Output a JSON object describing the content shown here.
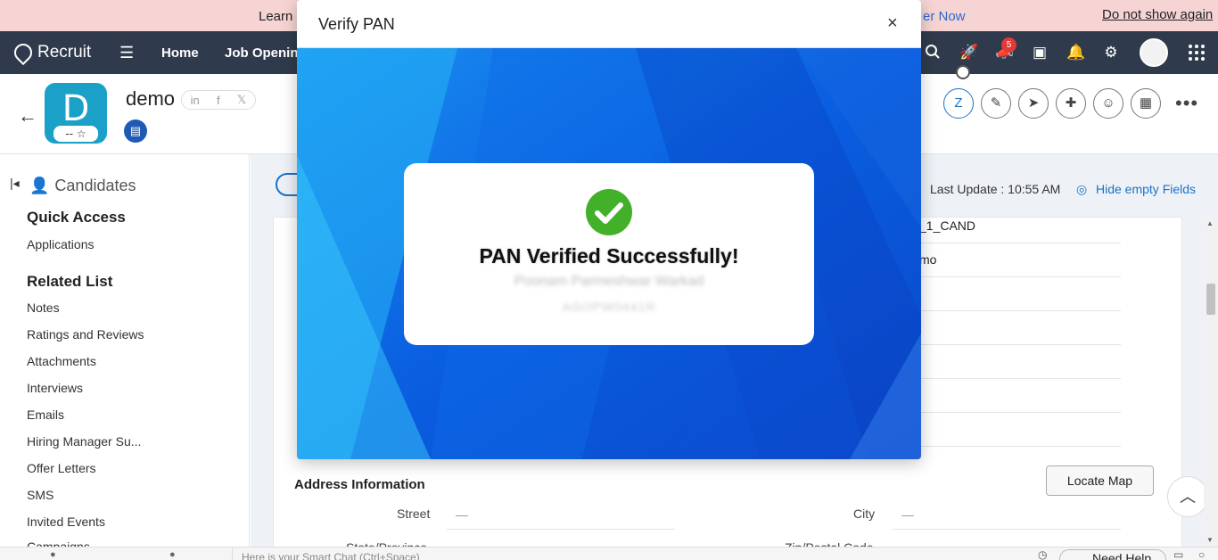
{
  "banner": {
    "learn_text": "Learn",
    "register_text": "er Now",
    "dismiss_text": "Do not show again"
  },
  "nav": {
    "app_name": "Recruit",
    "links": [
      "Home",
      "Job Opening"
    ],
    "notification_count": "5"
  },
  "record": {
    "initial": "D",
    "name": "demo",
    "rating": "-- ☆",
    "social": [
      "in",
      "f",
      "𝕏"
    ]
  },
  "sidebar": {
    "module": "Candidates",
    "quick_access_title": "Quick Access",
    "quick_access_items": [
      "Applications"
    ],
    "related_list_title": "Related List",
    "related_items": [
      "Notes",
      "Ratings and Reviews",
      "Attachments",
      "Interviews",
      "Emails",
      "Hiring Manager Su...",
      "Offer Letters",
      "SMS",
      "Invited Events",
      "Campaigns"
    ]
  },
  "main": {
    "last_update": "Last Update : 10:55 AM",
    "hide_empty": "Hide empty Fields",
    "field_values": [
      "_1_CAND",
      "mo",
      "",
      "",
      "",
      "",
      ""
    ],
    "address_title": "Address Information",
    "locate_map": "Locate Map",
    "street_label": "Street",
    "street_value": "—",
    "city_label": "City",
    "city_value": "—",
    "state_label": "State/Province",
    "zip_label": "Zip/Postal Code"
  },
  "bottom": {
    "chat_placeholder": "Here is your Smart Chat (Ctrl+Space)",
    "need_help": "Need Help"
  },
  "modal": {
    "title": "Verify PAN",
    "close": "×",
    "success_message": "PAN Verified Successfully!",
    "holder_name": "Poonam Parmeshwar Warkad",
    "pan_number": "AGOPW0441R"
  },
  "colors": {
    "navbar": "#2f3b4c",
    "accent": "#1a73c8",
    "banner": "#f6d4d4",
    "success": "#43b02a",
    "modal_bg": "#0a5fd8"
  }
}
